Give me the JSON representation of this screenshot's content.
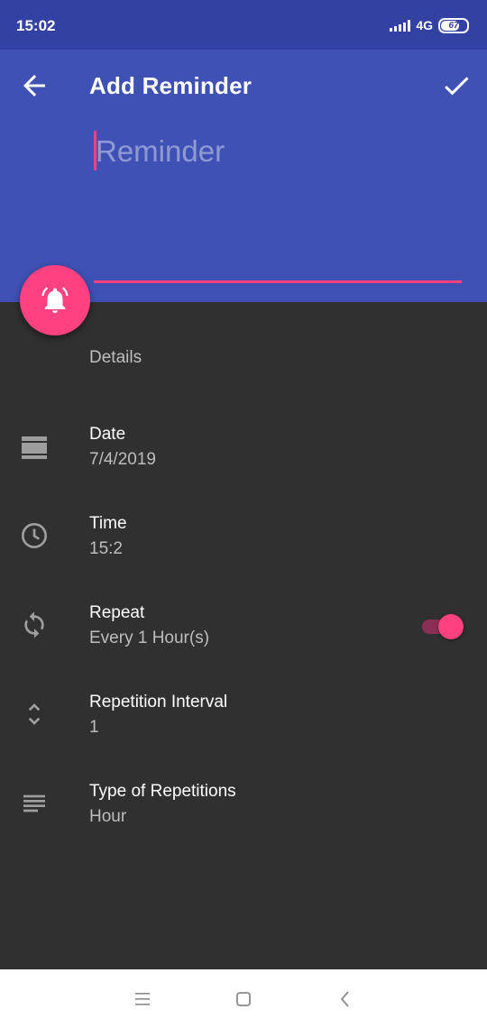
{
  "status_bar": {
    "time": "15:02",
    "network": "4G",
    "battery": "67"
  },
  "app_bar": {
    "title": "Add Reminder",
    "back_icon": "arrow-back-icon",
    "confirm_icon": "check-icon"
  },
  "reminder": {
    "placeholder": "Reminder",
    "value": ""
  },
  "fab": {
    "icon": "alarm-bell-icon"
  },
  "details": {
    "section_label": "Details",
    "items": [
      {
        "icon": "calendar-icon",
        "label": "Date",
        "value": "7/4/2019"
      },
      {
        "icon": "clock-icon",
        "label": "Time",
        "value": "15:2"
      },
      {
        "icon": "repeat-icon",
        "label": "Repeat",
        "value": "Every 1 Hour(s)",
        "toggle_on": true
      },
      {
        "icon": "unfold-icon",
        "label": "Repetition Interval",
        "value": "1"
      },
      {
        "icon": "lines-icon",
        "label": "Type of Repetitions",
        "value": "Hour"
      }
    ]
  },
  "colors": {
    "primary": "#3F51B5",
    "primary_dark": "#3342A2",
    "accent": "#FF4081",
    "background": "#303030"
  },
  "nav_bar": {
    "menu_icon": "menu-icon",
    "home_icon": "home-square-icon",
    "back_icon": "nav-back-icon"
  }
}
